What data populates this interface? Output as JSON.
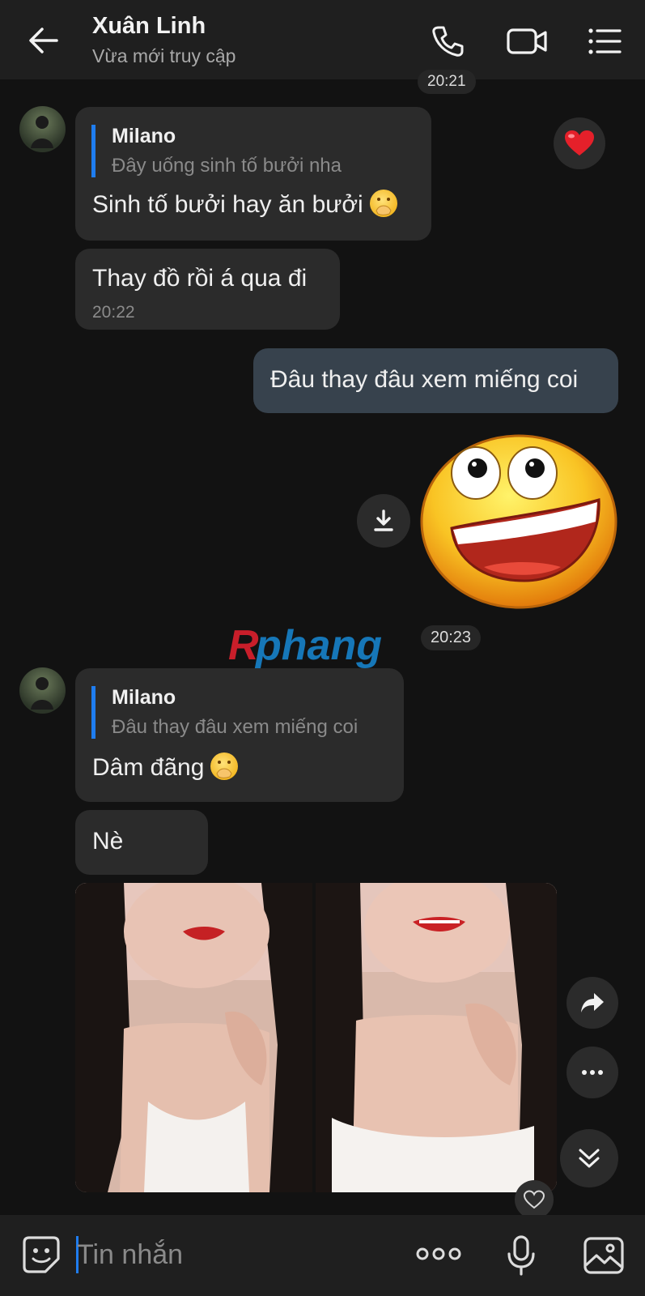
{
  "header": {
    "title": "Xuân Linh",
    "subtitle": "Vừa mới truy cập"
  },
  "messages": {
    "time_top": "20:21",
    "m1": {
      "quote_name": "Milano",
      "quote_text": "Đây uống sinh tố bưởi nha",
      "text": "Sinh tố bưởi hay ăn bưởi",
      "reaction": "heart"
    },
    "m2": {
      "text": "Thay đồ rồi á qua đi",
      "time": "20:22"
    },
    "m3": {
      "text": "Đâu thay đâu xem miếng coi"
    },
    "time_mid": "20:23",
    "watermark": "Rphang",
    "m4": {
      "quote_name": "Milano",
      "quote_text": "Đâu thay đâu xem miếng coi",
      "text": "Dâm đãng"
    },
    "m5": {
      "text": "Nè"
    }
  },
  "composer": {
    "placeholder": "Tin nhắn"
  },
  "colors": {
    "accent": "#1f7df0",
    "bubble_in": "#2b2b2b",
    "bubble_out": "#37424d",
    "header": "#1f1f1f"
  }
}
